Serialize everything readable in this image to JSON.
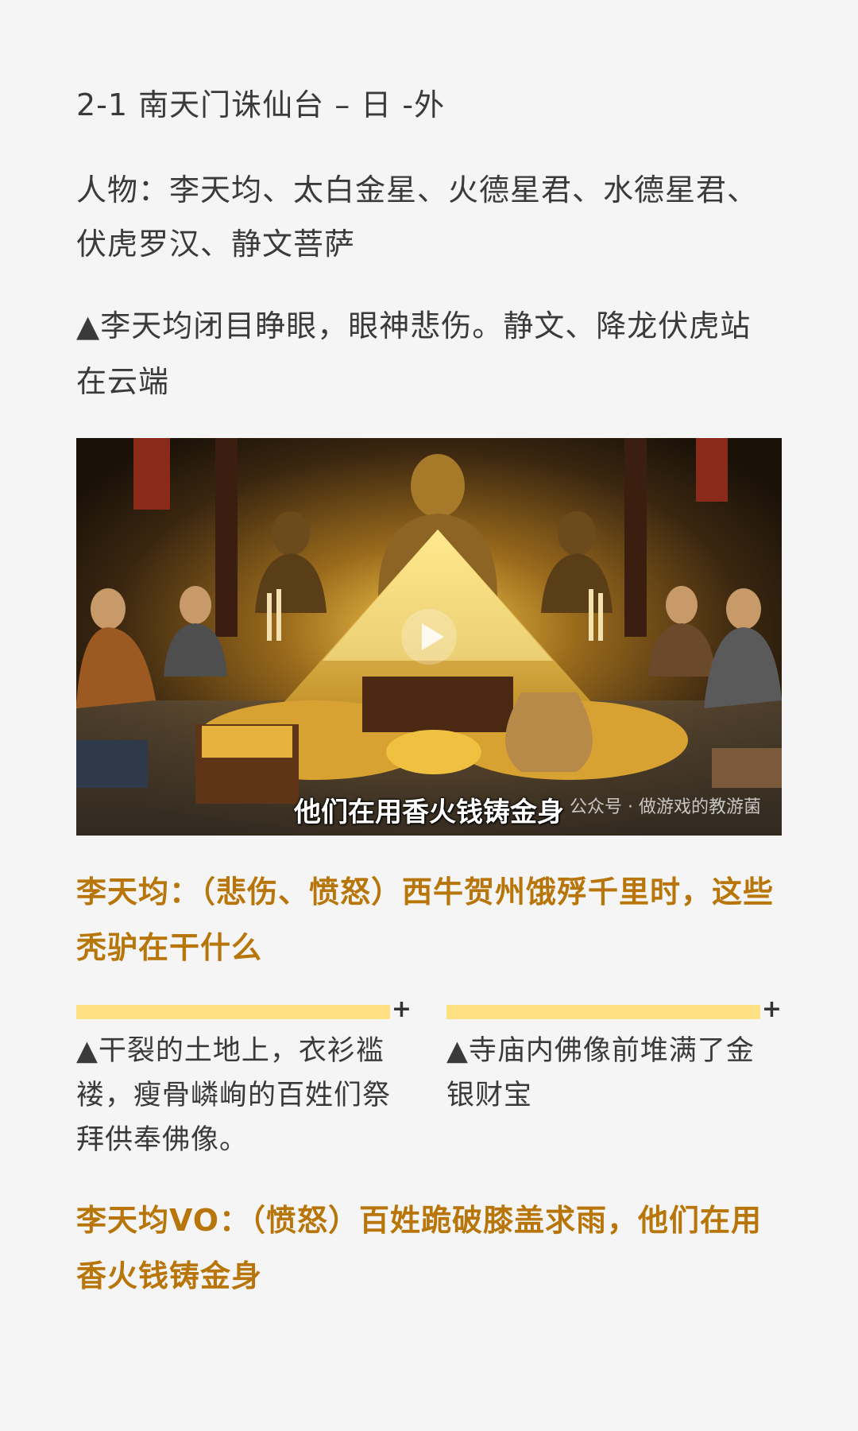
{
  "scene_heading": "2-1 南天门诛仙台 – 日 -外",
  "characters": "人物：李天均、太白金星、火德星君、水德星君、伏虎罗汉、静文菩萨",
  "action_1": "▲李天均闭目睁眼，眼神悲伤。静文、降龙伏虎站在云端",
  "video": {
    "subtitle": "他们在用香火钱铸金身",
    "watermark": "公众号 · 做游戏的教游菌",
    "play_icon": "play-icon"
  },
  "dialogue_1": "李天均：（悲伤、愤怒）西牛贺州饿殍千里时，这些秃驴在干什么",
  "columns": [
    {
      "plus": "+",
      "text": "▲干裂的土地上，衣衫褴褛，瘦骨嶙峋的百姓们祭拜供奉佛像。"
    },
    {
      "plus": "+",
      "text": "▲寺庙内佛像前堆满了金银财宝"
    }
  ],
  "dialogue_2": "李天均VO：（愤怒）百姓跪破膝盖求雨，他们在用香火钱铸金身",
  "colors": {
    "background": "#f5f5f5",
    "dialogue": "#b8760a",
    "highlight_bar": "#ffe082"
  }
}
